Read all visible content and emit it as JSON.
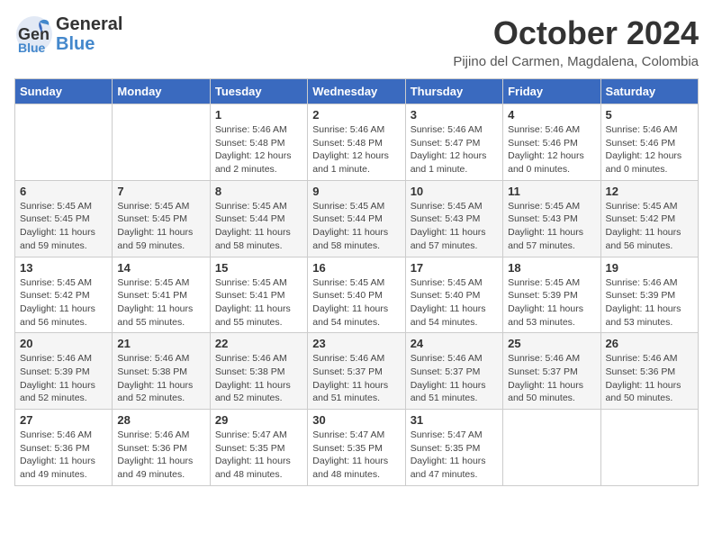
{
  "header": {
    "logo_general": "General",
    "logo_blue": "Blue",
    "month": "October 2024",
    "location": "Pijino del Carmen, Magdalena, Colombia"
  },
  "days_of_week": [
    "Sunday",
    "Monday",
    "Tuesday",
    "Wednesday",
    "Thursday",
    "Friday",
    "Saturday"
  ],
  "weeks": [
    [
      {
        "day": "",
        "info": ""
      },
      {
        "day": "",
        "info": ""
      },
      {
        "day": "1",
        "info": "Sunrise: 5:46 AM\nSunset: 5:48 PM\nDaylight: 12 hours\nand 2 minutes."
      },
      {
        "day": "2",
        "info": "Sunrise: 5:46 AM\nSunset: 5:48 PM\nDaylight: 12 hours\nand 1 minute."
      },
      {
        "day": "3",
        "info": "Sunrise: 5:46 AM\nSunset: 5:47 PM\nDaylight: 12 hours\nand 1 minute."
      },
      {
        "day": "4",
        "info": "Sunrise: 5:46 AM\nSunset: 5:46 PM\nDaylight: 12 hours\nand 0 minutes."
      },
      {
        "day": "5",
        "info": "Sunrise: 5:46 AM\nSunset: 5:46 PM\nDaylight: 12 hours\nand 0 minutes."
      }
    ],
    [
      {
        "day": "6",
        "info": "Sunrise: 5:45 AM\nSunset: 5:45 PM\nDaylight: 11 hours\nand 59 minutes."
      },
      {
        "day": "7",
        "info": "Sunrise: 5:45 AM\nSunset: 5:45 PM\nDaylight: 11 hours\nand 59 minutes."
      },
      {
        "day": "8",
        "info": "Sunrise: 5:45 AM\nSunset: 5:44 PM\nDaylight: 11 hours\nand 58 minutes."
      },
      {
        "day": "9",
        "info": "Sunrise: 5:45 AM\nSunset: 5:44 PM\nDaylight: 11 hours\nand 58 minutes."
      },
      {
        "day": "10",
        "info": "Sunrise: 5:45 AM\nSunset: 5:43 PM\nDaylight: 11 hours\nand 57 minutes."
      },
      {
        "day": "11",
        "info": "Sunrise: 5:45 AM\nSunset: 5:43 PM\nDaylight: 11 hours\nand 57 minutes."
      },
      {
        "day": "12",
        "info": "Sunrise: 5:45 AM\nSunset: 5:42 PM\nDaylight: 11 hours\nand 56 minutes."
      }
    ],
    [
      {
        "day": "13",
        "info": "Sunrise: 5:45 AM\nSunset: 5:42 PM\nDaylight: 11 hours\nand 56 minutes."
      },
      {
        "day": "14",
        "info": "Sunrise: 5:45 AM\nSunset: 5:41 PM\nDaylight: 11 hours\nand 55 minutes."
      },
      {
        "day": "15",
        "info": "Sunrise: 5:45 AM\nSunset: 5:41 PM\nDaylight: 11 hours\nand 55 minutes."
      },
      {
        "day": "16",
        "info": "Sunrise: 5:45 AM\nSunset: 5:40 PM\nDaylight: 11 hours\nand 54 minutes."
      },
      {
        "day": "17",
        "info": "Sunrise: 5:45 AM\nSunset: 5:40 PM\nDaylight: 11 hours\nand 54 minutes."
      },
      {
        "day": "18",
        "info": "Sunrise: 5:45 AM\nSunset: 5:39 PM\nDaylight: 11 hours\nand 53 minutes."
      },
      {
        "day": "19",
        "info": "Sunrise: 5:46 AM\nSunset: 5:39 PM\nDaylight: 11 hours\nand 53 minutes."
      }
    ],
    [
      {
        "day": "20",
        "info": "Sunrise: 5:46 AM\nSunset: 5:39 PM\nDaylight: 11 hours\nand 52 minutes."
      },
      {
        "day": "21",
        "info": "Sunrise: 5:46 AM\nSunset: 5:38 PM\nDaylight: 11 hours\nand 52 minutes."
      },
      {
        "day": "22",
        "info": "Sunrise: 5:46 AM\nSunset: 5:38 PM\nDaylight: 11 hours\nand 52 minutes."
      },
      {
        "day": "23",
        "info": "Sunrise: 5:46 AM\nSunset: 5:37 PM\nDaylight: 11 hours\nand 51 minutes."
      },
      {
        "day": "24",
        "info": "Sunrise: 5:46 AM\nSunset: 5:37 PM\nDaylight: 11 hours\nand 51 minutes."
      },
      {
        "day": "25",
        "info": "Sunrise: 5:46 AM\nSunset: 5:37 PM\nDaylight: 11 hours\nand 50 minutes."
      },
      {
        "day": "26",
        "info": "Sunrise: 5:46 AM\nSunset: 5:36 PM\nDaylight: 11 hours\nand 50 minutes."
      }
    ],
    [
      {
        "day": "27",
        "info": "Sunrise: 5:46 AM\nSunset: 5:36 PM\nDaylight: 11 hours\nand 49 minutes."
      },
      {
        "day": "28",
        "info": "Sunrise: 5:46 AM\nSunset: 5:36 PM\nDaylight: 11 hours\nand 49 minutes."
      },
      {
        "day": "29",
        "info": "Sunrise: 5:47 AM\nSunset: 5:35 PM\nDaylight: 11 hours\nand 48 minutes."
      },
      {
        "day": "30",
        "info": "Sunrise: 5:47 AM\nSunset: 5:35 PM\nDaylight: 11 hours\nand 48 minutes."
      },
      {
        "day": "31",
        "info": "Sunrise: 5:47 AM\nSunset: 5:35 PM\nDaylight: 11 hours\nand 47 minutes."
      },
      {
        "day": "",
        "info": ""
      },
      {
        "day": "",
        "info": ""
      }
    ]
  ]
}
